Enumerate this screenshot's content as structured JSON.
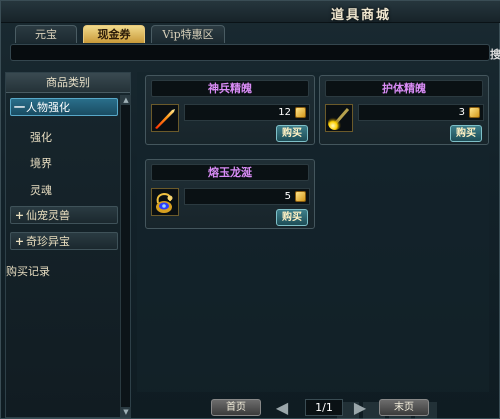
{
  "window": {
    "title": "道具商城"
  },
  "tabs": [
    {
      "label": "元宝",
      "active": false
    },
    {
      "label": "现金券",
      "active": true
    },
    {
      "label": "Vip特惠区",
      "active": false
    }
  ],
  "search": {
    "label": "搜"
  },
  "sidebar": {
    "header": "商品类别",
    "categories": [
      {
        "symbol": "一",
        "label": "人物强化",
        "expanded": true,
        "selected": true,
        "subitems": [
          "强化",
          "境界",
          "灵魂"
        ]
      },
      {
        "symbol": "+",
        "label": "仙宠灵兽",
        "expanded": false
      },
      {
        "symbol": "+",
        "label": "奇珍异宝",
        "expanded": false
      }
    ],
    "purchase_record": "购买记录"
  },
  "items": [
    {
      "name": "神兵精魄",
      "price": "12",
      "buy_label": "购买",
      "icon": "flame-streak-icon"
    },
    {
      "name": "护体精魄",
      "price": "3",
      "buy_label": "购买",
      "icon": "golden-comet-icon"
    },
    {
      "name": "熔玉龙涎",
      "price": "5",
      "buy_label": "购买",
      "icon": "dragon-gourd-icon"
    }
  ],
  "pager": {
    "first_label": "首页",
    "last_label": "末页",
    "page_text": "1/1"
  },
  "colors": {
    "accent_gold": "#e8c87a",
    "item_name": "#d98cf5",
    "selected_blue": "#2a6e8a"
  }
}
